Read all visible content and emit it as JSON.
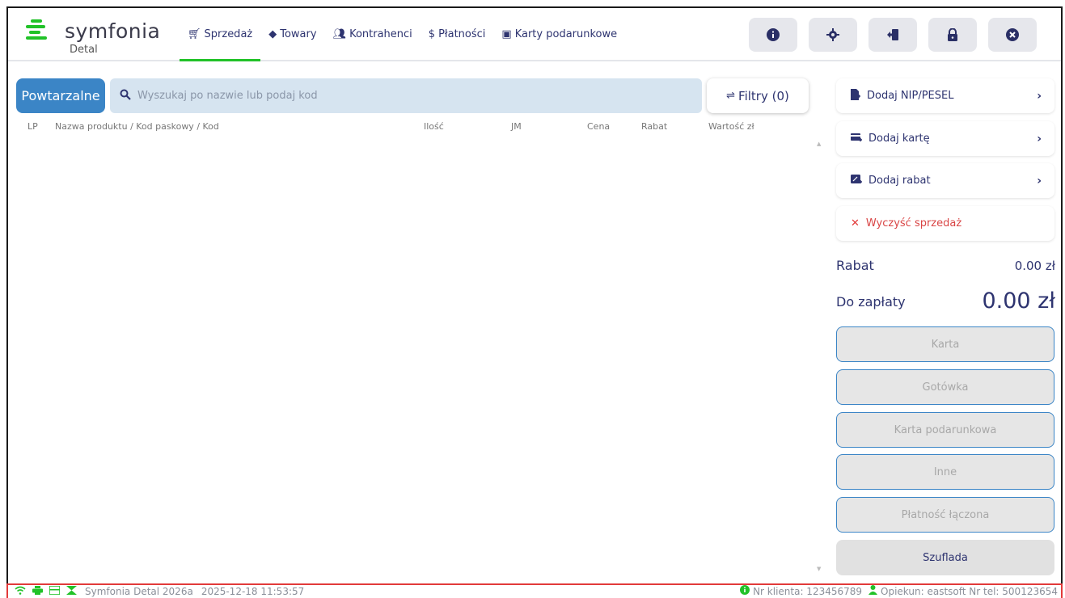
{
  "app": {
    "logo_text": "symfonia",
    "logo_sub": "Detal"
  },
  "nav": [
    {
      "label": "Sprzedaż",
      "icon": "cart-icon",
      "active": true
    },
    {
      "label": "Towary",
      "icon": "tag-icon"
    },
    {
      "label": "Kontrahenci",
      "icon": "users-search-icon"
    },
    {
      "label": "Płatności",
      "icon": "dollar-circle-icon"
    },
    {
      "label": "Karty podarunkowe",
      "icon": "gift-card-icon"
    }
  ],
  "header_buttons": [
    {
      "name": "info-button",
      "icon": "info-icon",
      "glyph": "i"
    },
    {
      "name": "settings-button",
      "icon": "gear-icon",
      "glyph": "✱"
    },
    {
      "name": "logout-button",
      "icon": "exit-icon",
      "glyph": "⇤"
    },
    {
      "name": "lock-button",
      "icon": "lock-icon",
      "glyph": "🔒"
    },
    {
      "name": "close-button",
      "icon": "close-icon",
      "glyph": "✕"
    }
  ],
  "toolbar": {
    "repeat_label": "Powtarzalne",
    "search_placeholder": "Wyszukaj po nazwie lub podaj kod",
    "filters_label": "Filtry (0)"
  },
  "table": {
    "columns": [
      "LP",
      "Nazwa produktu / Kod paskowy / Kod",
      "Ilość",
      "JM",
      "Cena",
      "Rabat",
      "Wartość zł"
    ]
  },
  "actions": {
    "add_nip": "Dodaj NIP/PESEL",
    "add_card": "Dodaj kartę",
    "add_discount": "Dodaj rabat",
    "clear_sale": "Wyczyść sprzedaż"
  },
  "summary": {
    "discount_label": "Rabat",
    "discount_value": "0.00 zł",
    "to_pay_label": "Do zapłaty",
    "to_pay_value": "0.00 zł"
  },
  "payments": {
    "card": "Karta",
    "cash": "Gotówka",
    "gift_card": "Karta podarunkowa",
    "other": "Inne",
    "combined": "Płatność łączona",
    "drawer": "Szuflada"
  },
  "status": {
    "version": "Symfonia Detal 2026a",
    "datetime": "2025-12-18 11:53:57",
    "client_no": "Nr klienta: 123456789",
    "operator": "Opiekun: eastsoft Nr tel: 500123654"
  },
  "colors": {
    "accent": "#3b85c6",
    "brand_green": "#21c228",
    "nav_text": "#2e3470",
    "danger": "#e23a3a"
  }
}
